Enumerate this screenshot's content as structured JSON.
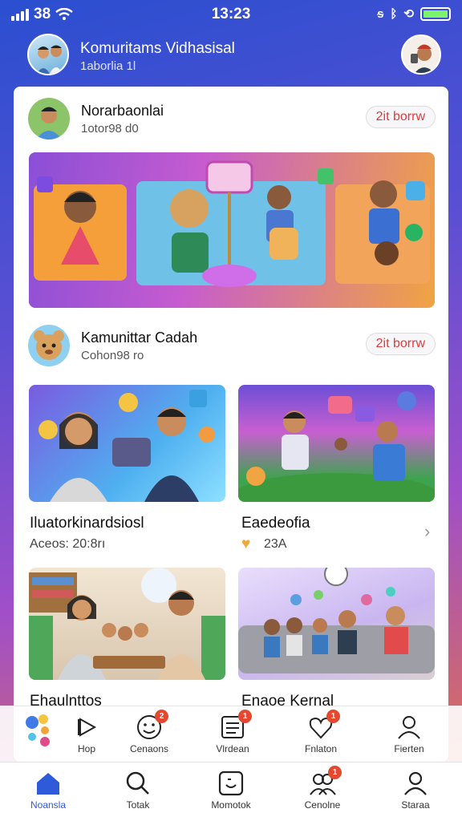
{
  "status": {
    "left_text": "38",
    "time": "13:23"
  },
  "header": {
    "title": "Komuritams Vidhasisal",
    "subtitle": "1aborlia 1l"
  },
  "post1": {
    "title": "Norarbaonlai",
    "subtitle": "1otor98 d0",
    "pill": "2it borrw"
  },
  "post2": {
    "title": "Kamunittar Cadah",
    "subtitle": "Cohon98 ro",
    "pill": "2it borrw"
  },
  "tiles": [
    {
      "title": "Iluatorkinardsiosl",
      "sub": "Aceos: 20:8rı"
    },
    {
      "title": "Eaedeofia",
      "sub": "23A"
    },
    {
      "title": "Ehaulnttos",
      "sub": ""
    },
    {
      "title": "Enaoe Kernal",
      "sub": ""
    }
  ],
  "nav_top": [
    {
      "label": "",
      "icon": "bubbles-icon"
    },
    {
      "label": "Hop",
      "icon": "play-icon"
    },
    {
      "label": "Cenaons",
      "icon": "smiley-icon",
      "badge": "2"
    },
    {
      "label": "Vlrdean",
      "icon": "list-icon",
      "badge": "1"
    },
    {
      "label": "Fnlaton",
      "icon": "heart-icon",
      "badge": "1"
    },
    {
      "label": "Fierten",
      "icon": "person-icon"
    }
  ],
  "nav_bottom": [
    {
      "label": "Noansla",
      "icon": "home-icon"
    },
    {
      "label": "Totak",
      "icon": "search-icon"
    },
    {
      "label": "Momotok",
      "icon": "chat-icon"
    },
    {
      "label": "Cenolne",
      "icon": "group-icon",
      "badge": "1"
    },
    {
      "label": "Staraa",
      "icon": "profile-icon"
    }
  ],
  "colors": {
    "accent": "#2f5bdb",
    "badge": "#e5482f",
    "pill_text": "#e23b3b"
  }
}
